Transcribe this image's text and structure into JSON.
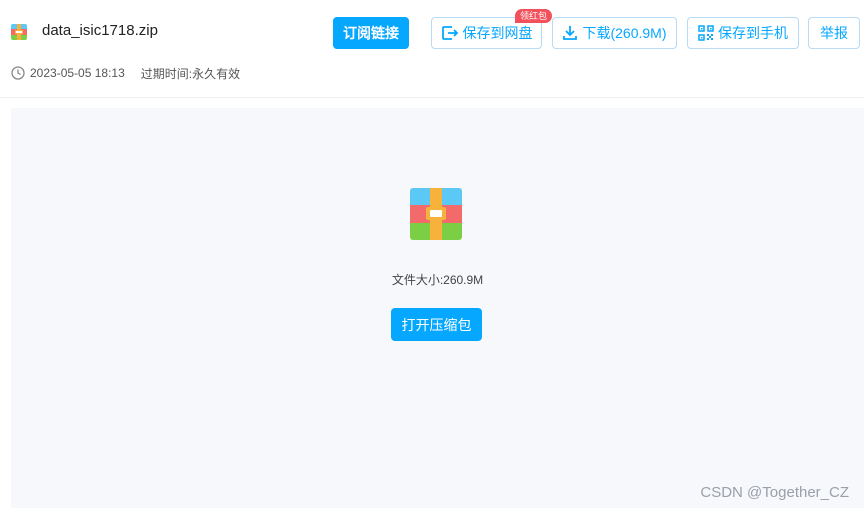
{
  "file": {
    "name": "data_isic1718.zip",
    "date": "2023-05-05 18:13",
    "expire_label": "过期时间:",
    "expire_value": "永久有效",
    "size_text": "文件大小:260.9M"
  },
  "toolbar": {
    "subscribe_label": "订阅链接",
    "save_to_disk_label": "保存到网盘",
    "save_badge": "领红包",
    "download_label": "下载(260.9M)",
    "save_to_phone_label": "保存到手机",
    "report_label": "举报"
  },
  "main": {
    "open_button_label": "打开压缩包"
  },
  "watermark": "CSDN @Together_CZ",
  "colors": {
    "accent": "#06a7ff",
    "badge": "#f2505a",
    "panel_bg": "#f6f8fc"
  },
  "icons": [
    "archive-icon",
    "clock-icon",
    "save-disk-icon",
    "download-icon",
    "qrcode-icon"
  ]
}
